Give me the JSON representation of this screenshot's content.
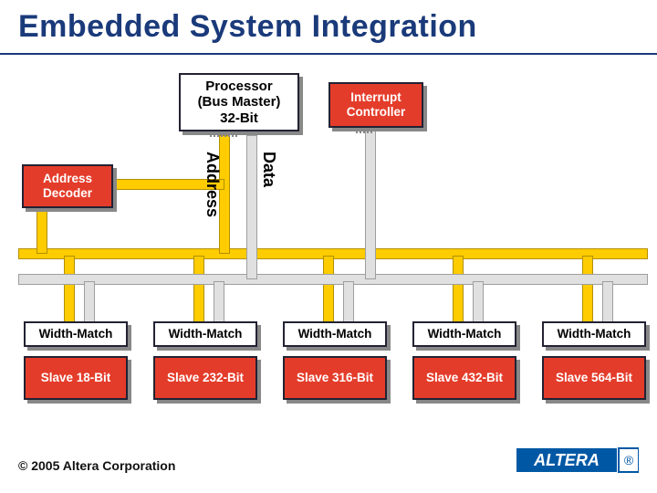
{
  "title": "Embedded System Integration",
  "footer": "© 2005 Altera Corporation",
  "logo_text": "ALTERA",
  "blocks": {
    "processor": "Processor\n(Bus Master)\n32-Bit",
    "interrupt_controller": "Interrupt\nController",
    "address_decoder": "Address\nDecoder"
  },
  "bus_labels": {
    "address": "Address",
    "data": "Data"
  },
  "width_match_label": "Width-Match",
  "slaves": [
    {
      "name": "Slave 1",
      "width": "8-Bit"
    },
    {
      "name": "Slave 2",
      "width": "32-Bit"
    },
    {
      "name": "Slave 3",
      "width": "16-Bit"
    },
    {
      "name": "Slave 4",
      "width": "32-Bit"
    },
    {
      "name": "Slave 5",
      "width": "64-Bit"
    }
  ],
  "colors": {
    "red": "#e43c2a",
    "yellow": "#ffcc00",
    "gray": "#bfbfbf",
    "title": "#1a3a7a"
  }
}
